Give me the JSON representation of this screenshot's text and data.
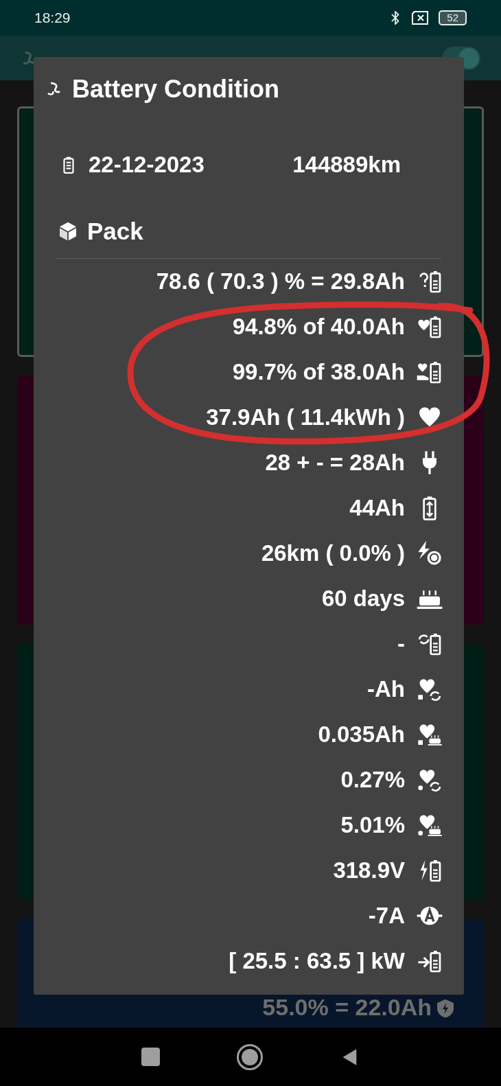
{
  "status_bar": {
    "time": "18:29",
    "battery": "52"
  },
  "dialog": {
    "title": "Battery Condition",
    "date": "22-12-2023",
    "odometer": "144889km",
    "section": "Pack",
    "rows": [
      "78.6 ( 70.3 ) % = 29.8Ah",
      "94.8% of 40.0Ah",
      "99.7% of 38.0Ah",
      "37.9Ah ( 11.4kWh )",
      "28 + - = 28Ah",
      "44Ah",
      "26km ( 0.0% )",
      "60 days",
      "-",
      "-Ah",
      "0.035Ah",
      "0.27%",
      "5.01%",
      "318.9V",
      "-7A",
      "[ 25.5 : 63.5 ] kW"
    ]
  },
  "app_bar": {
    "toggle": {
      "on": true
    }
  },
  "background": {
    "card_text": "55.0% = 22.0Ah"
  }
}
